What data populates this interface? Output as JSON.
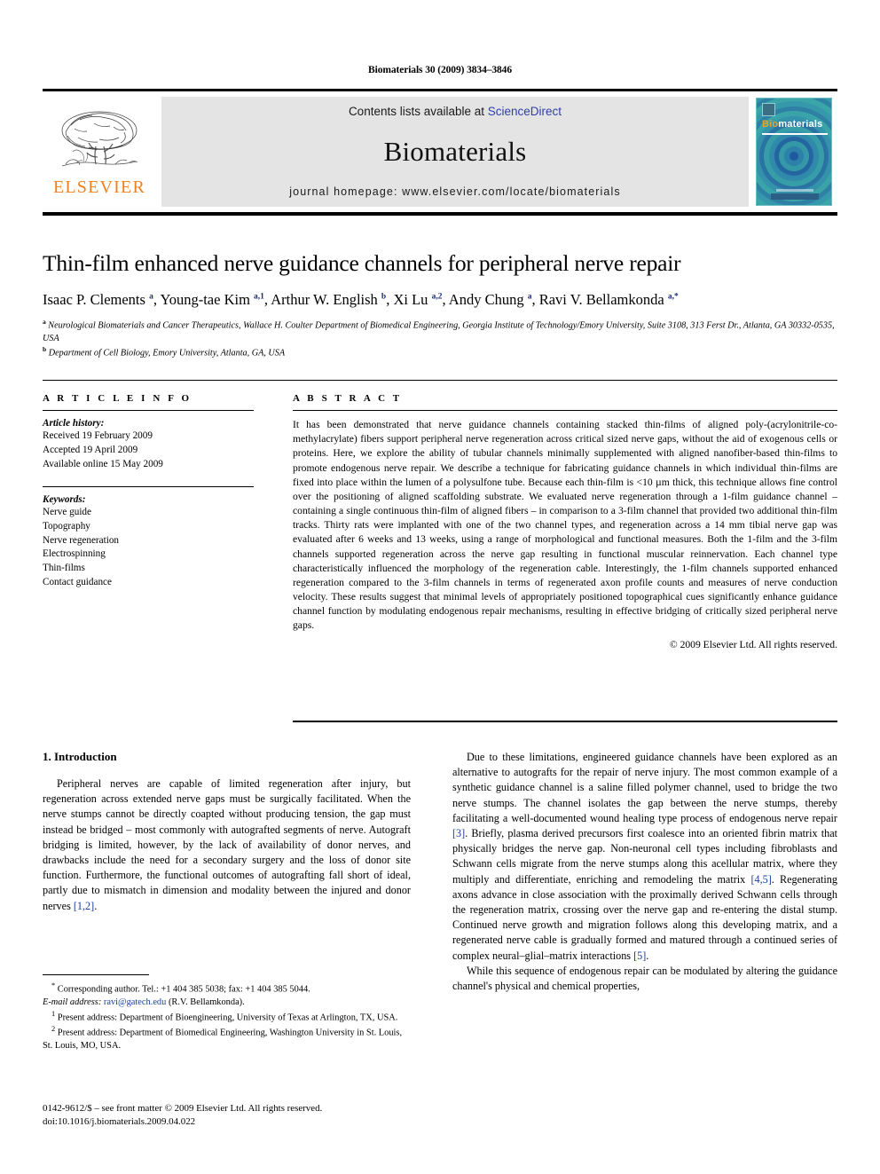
{
  "running_head": "Biomaterials 30 (2009) 3834–3846",
  "masthead": {
    "publisher_name": "ELSEVIER",
    "contents_prefix": "Contents lists available at ",
    "contents_link": "ScienceDirect",
    "journal_title": "Biomaterials",
    "homepage": "journal homepage: www.elsevier.com/locate/biomaterials",
    "cover": {
      "title_part1": "Bio",
      "title_part2": "materials"
    },
    "accent_orange": "#F08020",
    "link_blue": "#2f3fa8",
    "band_gray": "#e4e4e4"
  },
  "article": {
    "title": "Thin-film enhanced nerve guidance channels for peripheral nerve repair",
    "authors_html": "Isaac P. Clements <sup>a</sup>, Young-tae Kim <sup>a,1</sup>, Arthur W. English <sup>b</sup>, Xi Lu <sup>a,2</sup>, Andy Chung <sup>a</sup>, Ravi V. Bellamkonda <sup>a,*</sup>",
    "affiliation_a": "Neurological Biomaterials and Cancer Therapeutics, Wallace H. Coulter Department of Biomedical Engineering, Georgia Institute of Technology/Emory University, Suite 3108, 313 Ferst Dr., Atlanta, GA 30332-0535, USA",
    "affiliation_b": "Department of Cell Biology, Emory University, Atlanta, GA, USA"
  },
  "article_info": {
    "heading": "A R T I C L E  I N F O",
    "history_label": "Article history:",
    "history": [
      "Received 19 February 2009",
      "Accepted 19 April 2009",
      "Available online 15 May 2009"
    ],
    "keywords_label": "Keywords:",
    "keywords": [
      "Nerve guide",
      "Topography",
      "Nerve regeneration",
      "Electrospinning",
      "Thin-films",
      "Contact guidance"
    ]
  },
  "abstract": {
    "heading": "A B S T R A C T",
    "text": "It has been demonstrated that nerve guidance channels containing stacked thin-films of aligned poly-(acrylonitrile-co-methylacrylate) fibers support peripheral nerve regeneration across critical sized nerve gaps, without the aid of exogenous cells or proteins. Here, we explore the ability of tubular channels minimally supplemented with aligned nanofiber-based thin-films to promote endogenous nerve repair. We describe a technique for fabricating guidance channels in which individual thin-films are fixed into place within the lumen of a polysulfone tube. Because each thin-film is <10 µm thick, this technique allows fine control over the positioning of aligned scaffolding substrate. We evaluated nerve regeneration through a 1-film guidance channel – containing a single continuous thin-film of aligned fibers – in comparison to a 3-film channel that provided two additional thin-film tracks. Thirty rats were implanted with one of the two channel types, and regeneration across a 14 mm tibial nerve gap was evaluated after 6 weeks and 13 weeks, using a range of morphological and functional measures. Both the 1-film and the 3-film channels supported regeneration across the nerve gap resulting in functional muscular reinnervation. Each channel type characteristically influenced the morphology of the regeneration cable. Interestingly, the 1-film channels supported enhanced regeneration compared to the 3-film channels in terms of regenerated axon profile counts and measures of nerve conduction velocity. These results suggest that minimal levels of appropriately positioned topographical cues significantly enhance guidance channel function by modulating endogenous repair mechanisms, resulting in effective bridging of critically sized peripheral nerve gaps.",
    "copyright": "© 2009 Elsevier Ltd. All rights reserved."
  },
  "body": {
    "section1_heading": "1. Introduction",
    "left_paragraph_1_pre": "Peripheral nerves are capable of limited regeneration after injury, but regeneration across extended nerve gaps must be surgically facilitated. When the nerve stumps cannot be directly coapted without producing tension, the gap must instead be bridged – most commonly with autografted segments of nerve. Autograft bridging is limited, however, by the lack of availability of donor nerves, and drawbacks include the need for a secondary surgery and the loss of donor site function. Furthermore, the functional outcomes of autografting fall short of ideal, partly due to mismatch in dimension and modality between the injured and donor nerves ",
    "left_paragraph_1_ref": "[1,2]",
    "left_paragraph_1_post": ".",
    "right_p1_a": "Due to these limitations, engineered guidance channels have been explored as an alternative to autografts for the repair of nerve injury. The most common example of a synthetic guidance channel is a saline filled polymer channel, used to bridge the two nerve stumps. The channel isolates the gap between the nerve stumps, thereby facilitating a well-documented wound healing type process of endogenous nerve repair ",
    "right_p1_ref1": "[3]",
    "right_p1_b": ". Briefly, plasma derived precursors first coalesce into an oriented fibrin matrix that physically bridges the nerve gap. Non-neuronal cell types including fibroblasts and Schwann cells migrate from the nerve stumps along this acellular matrix, where they multiply and differentiate, enriching and remodeling the matrix ",
    "right_p1_ref2": "[4,5]",
    "right_p1_c": ". Regenerating axons advance in close association with the proximally derived Schwann cells through the regeneration matrix, crossing over the nerve gap and re-entering the distal stump. Continued nerve growth and migration follows along this developing matrix, and a regenerated nerve cable is gradually formed and matured through a continued series of complex neural–glial–matrix interactions ",
    "right_p1_ref3": "[5]",
    "right_p1_d": ".",
    "right_p2": "While this sequence of endogenous repair can be modulated by altering the guidance channel's physical and chemical properties,"
  },
  "footnotes": {
    "corresponding_mark": "*",
    "corresponding_text": "Corresponding author. Tel.: +1 404 385 5038; fax: +1 404 385 5044.",
    "email_label": "E-mail address:",
    "email": "ravi@gatech.edu",
    "email_owner": "(R.V. Bellamkonda).",
    "note1_mark": "1",
    "note1": "Present address: Department of Bioengineering, University of Texas at Arlington, TX, USA.",
    "note2_mark": "2",
    "note2": "Present address: Department of Biomedical Engineering, Washington University in St. Louis, St. Louis, MO, USA."
  },
  "imprint": {
    "line1": "0142-9612/$ – see front matter © 2009 Elsevier Ltd. All rights reserved.",
    "line2": "doi:10.1016/j.biomaterials.2009.04.022"
  }
}
